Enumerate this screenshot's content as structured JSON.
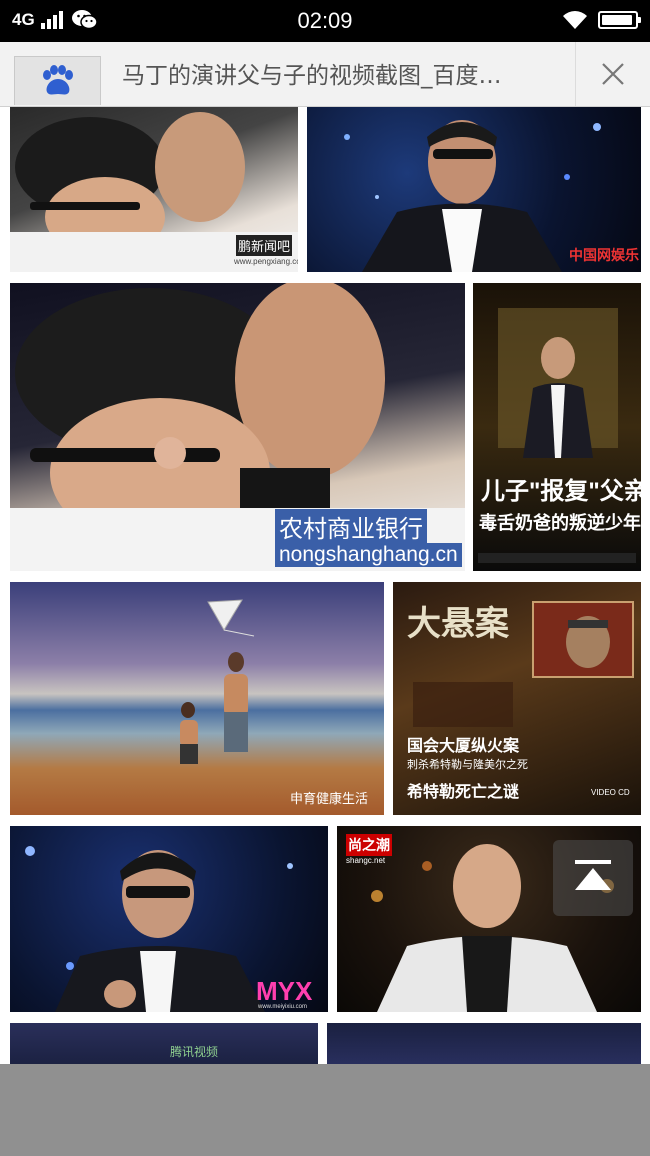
{
  "status_bar": {
    "network": "4G",
    "time": "02:09"
  },
  "tab": {
    "title": "马丁的演讲父与子的视频截图_百度…",
    "favicon": "baidu-paw-icon"
  },
  "images": [
    {
      "watermark": "鹏新闻吧",
      "watermark2": "www.pengxiang.cc"
    },
    {
      "watermark": "中国网娱乐"
    },
    {
      "watermark": "农村商业银行",
      "watermark2": "nongshanghang.cn"
    },
    {
      "caption_line1": "儿子\"报复\"父亲",
      "caption_line2": "毒舌奶爸的叛逆少年时"
    },
    {
      "watermark": "申育健康生活"
    },
    {
      "title": "大悬案",
      "line1": "国会大厦纵火案",
      "line2": "刺杀希特勒与隆美尔之死",
      "line3": "希特勒死亡之谜",
      "badge": "VIDEO CD"
    },
    {
      "watermark": "MYX",
      "watermark2": "www.meiyixiu.com"
    },
    {
      "watermark": "尚之潮",
      "watermark2": "shangc.net"
    },
    {
      "watermark": "腾讯视频"
    },
    {}
  ],
  "colors": {
    "status_bg": "#000000",
    "tab_bg": "#f2f2f2",
    "bottom_bar": "#909090"
  }
}
